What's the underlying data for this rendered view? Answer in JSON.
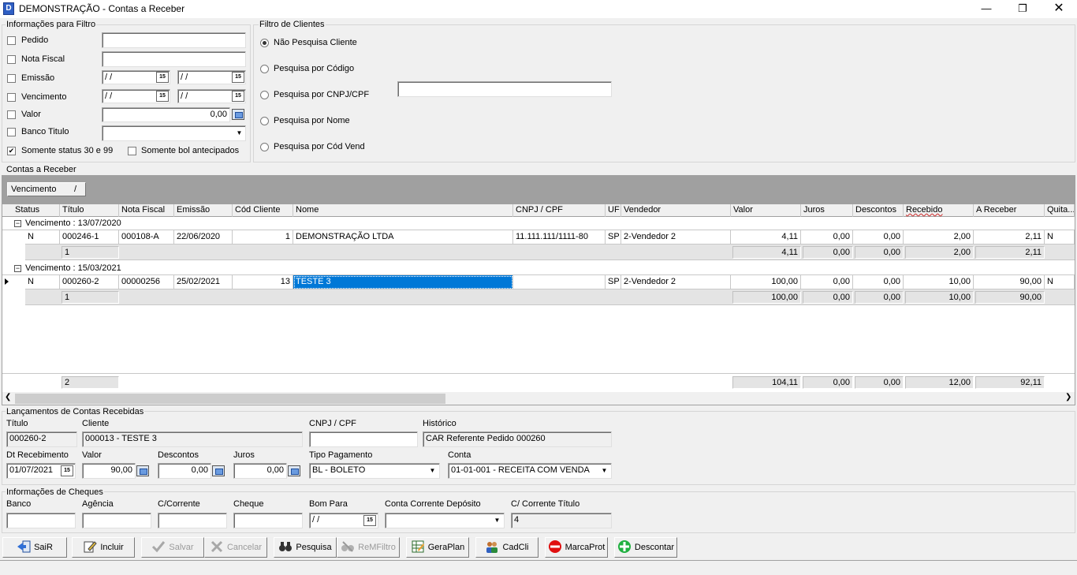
{
  "window": {
    "title": "DEMONSTRAÇÃO - Contas a Receber",
    "icon_letter": "D"
  },
  "filter_info": {
    "label": "Informações para Filtro",
    "pedido": "Pedido",
    "nota_fiscal": "Nota Fiscal",
    "emissao": "Emissão",
    "vencimento": "Vencimento",
    "valor": "Valor",
    "banco_titulo": "Banco Titulo",
    "date_blank": "/ /",
    "valor_value": "0,00",
    "cal_glyph": "15",
    "somente_status": "Somente status 30 e 99",
    "somente_status_checked": true,
    "somente_bol": "Somente bol antecipados"
  },
  "client_filter": {
    "label": "Filtro de Clientes",
    "options": [
      "Não Pesquisa Cliente",
      "Pesquisa por Código",
      "Pesquisa por CNPJ/CPF",
      "Pesquisa por Nome",
      "Pesquisa por Cód Vend"
    ],
    "selected": 0
  },
  "grid": {
    "label": "Contas a Receber",
    "group_chip": "Vencimento",
    "group_chip_sort": "/",
    "columns": [
      "Status",
      "Título",
      "Nota Fiscal",
      "Emissão",
      "Cód Cliente",
      "Nome",
      "CNPJ / CPF",
      "UF",
      "Vendedor",
      "Valor",
      "Juros",
      "Descontos",
      "Recebido",
      "A Receber",
      "Quita..."
    ],
    "groups": [
      {
        "header": "Vencimento : 13/07/2020",
        "row": {
          "status": "N",
          "titulo": "000246-1",
          "nota": "000108-A",
          "emissao": "22/06/2020",
          "cod": "1",
          "nome": "DEMONSTRAÇÃO LTDA",
          "cnpj": "11.111.111/1111-80",
          "uf": "SP",
          "vendedor": "2-Vendedor 2",
          "valor": "4,11",
          "juros": "0,00",
          "descontos": "0,00",
          "recebido": "2,00",
          "areceber": "2,11",
          "quita": "N"
        },
        "sum": {
          "count": "1",
          "valor": "4,11",
          "juros": "0,00",
          "descontos": "0,00",
          "recebido": "2,00",
          "areceber": "2,11"
        }
      },
      {
        "header": "Vencimento : 15/03/2021",
        "row": {
          "status": "N",
          "titulo": "000260-2",
          "nota": "00000256",
          "emissao": "25/02/2021",
          "cod": "13",
          "nome": "TESTE 3",
          "cnpj": "",
          "uf": "SP",
          "vendedor": "2-Vendedor 2",
          "valor": "100,00",
          "juros": "0,00",
          "descontos": "0,00",
          "recebido": "10,00",
          "areceber": "90,00",
          "quita": "N"
        },
        "sum": {
          "count": "1",
          "valor": "100,00",
          "juros": "0,00",
          "descontos": "0,00",
          "recebido": "10,00",
          "areceber": "90,00"
        }
      }
    ],
    "footer": {
      "count": "2",
      "valor": "104,11",
      "juros": "0,00",
      "descontos": "0,00",
      "recebido": "12,00",
      "areceber": "92,11"
    }
  },
  "lancamentos": {
    "label": "Lançamentos de Contas Recebidas",
    "titulo_label": "Título",
    "titulo": "000260-2",
    "cliente_label": "Cliente",
    "cliente": "000013 - TESTE 3",
    "cnpj_label": "CNPJ / CPF",
    "cnpj": "",
    "historico_label": "Histórico",
    "historico": "CAR Referente Pedido 000260",
    "dt_label": "Dt Recebimento",
    "dt": "01/07/2021",
    "valor_label": "Valor",
    "valor": "90,00",
    "descontos_label": "Descontos",
    "descontos": "0,00",
    "juros_label": "Juros",
    "juros": "0,00",
    "tipo_label": "Tipo Pagamento",
    "tipo": "BL - BOLETO",
    "conta_label": "Conta",
    "conta": "01-01-001 - RECEITA COM VENDA"
  },
  "cheques": {
    "label": "Informações de Cheques",
    "banco": "Banco",
    "agencia": "Agência",
    "corrente": "C/Corrente",
    "cheque": "Cheque",
    "bom_para": "Bom Para",
    "bom_para_value": "/ /",
    "deposito": "Conta Corrente Depósito",
    "corrente_titulo": "C/ Corrente Título",
    "corrente_titulo_value": "4"
  },
  "buttons": {
    "sair": "SaiR",
    "incluir": "Incluir",
    "salvar": "Salvar",
    "cancelar": "Cancelar",
    "pesquisa": "Pesquisa",
    "remfiltro": "ReMFiltro",
    "geraplan": "GeraPlan",
    "cadcli": "CadCli",
    "marcaprot": "MarcaProt",
    "descontar": "Descontar"
  },
  "colors": {
    "selection": "#0078d7",
    "window_bg": "#f0f0f0",
    "grid_group_panel": "#a0a0a0"
  }
}
